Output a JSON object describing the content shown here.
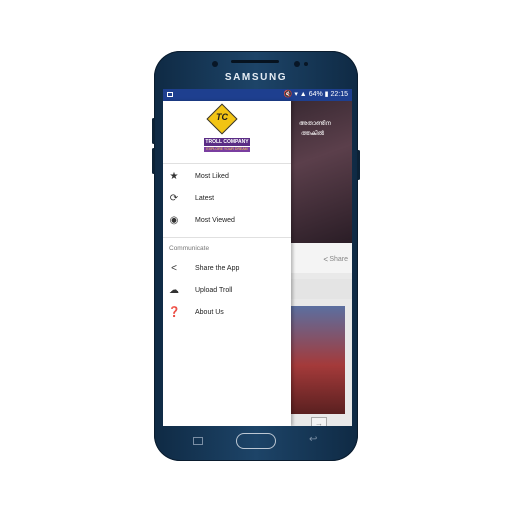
{
  "device": {
    "brand": "SAMSUNG"
  },
  "status_bar": {
    "battery": "64%",
    "time": "22:15"
  },
  "logo": {
    "mark": "TC",
    "name": "TROLL COMPANY",
    "tagline": "EXPLORE YOUR DREAM"
  },
  "menu": {
    "items": [
      {
        "label": "Most Liked",
        "icon": "star-icon"
      },
      {
        "label": "Latest",
        "icon": "refresh-icon"
      },
      {
        "label": "Most Viewed",
        "icon": "eye-icon"
      }
    ],
    "section_title": "Communicate",
    "communicate_items": [
      {
        "label": "Share the App",
        "icon": "share-icon"
      },
      {
        "label": "Upload Troll",
        "icon": "cloud-upload-icon"
      },
      {
        "label": "About Us",
        "icon": "help-icon"
      }
    ]
  },
  "feed": {
    "share_label": "Share",
    "post_text_line1": "അതാണ്ടിന",
    "post_text_line2": "ത്തകിൽ"
  }
}
